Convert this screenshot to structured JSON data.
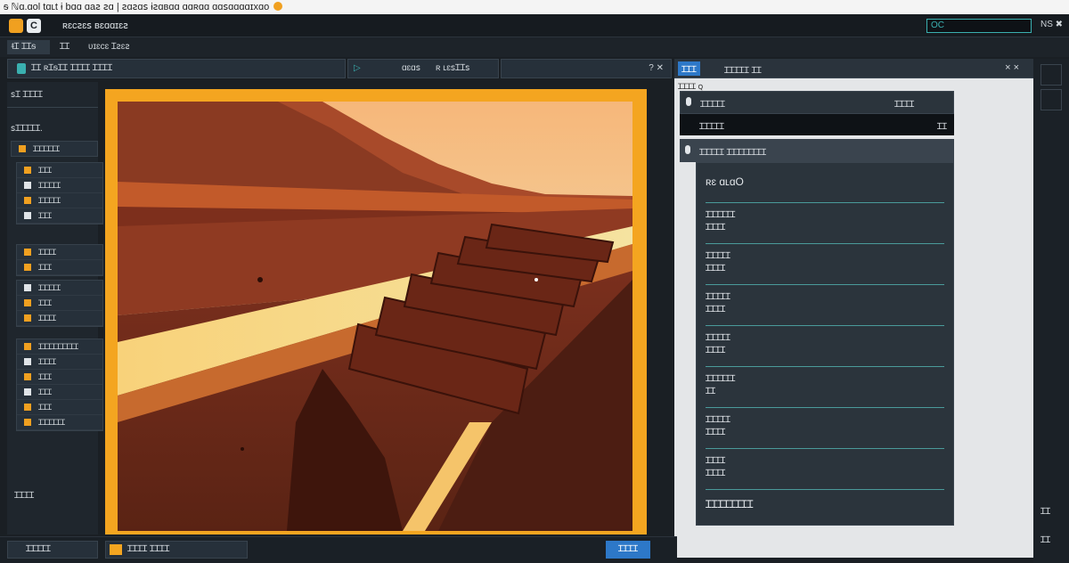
{
  "window": {
    "title": "ᵴ ℕɑ.ɑol tɑʟt ɨ bɑɑ ɑaꙅ ꙅɑ | ꙅɑꙅɑꜱ ɨꙅɑʙɑɑ ɑɑʀɑɑ ɑɑꜱɑɑɑɑɪxɑo"
  },
  "menubar": {
    "menu_text": "ʀɛcꙅɛꜱ ʙɛɑɑɪɛꙅ",
    "search_placeholder": "OC",
    "right_label": "NS ✖"
  },
  "toolbar": {
    "btn1": "ᵵꞮ ꞮꞮᵴ",
    "btn2": "ꞮꞮ",
    "btn3": "ʋɪɛcɛ Ɪꙅɛꙅ"
  },
  "left_panelbar": {
    "label": "ꞮꞮ ʀꞮᵴꞮꞮ ꞮꞮꞮꞮ ꞮꞮꞮꞮ"
  },
  "center_panelbar": {
    "left": "ɑɛɑꜱ",
    "right": "ʀ ʟɛꜱꞮꞮꜱ",
    "controls": "? ✕"
  },
  "right_panelbar": {
    "badge": "ꞮꞮꞮ",
    "label": "ꞮꞮꞮꞮꞮ ꞮꞮ",
    "controls": "× ×"
  },
  "leftpanel": {
    "heading1": "ꜱꞮ ꞮꞮꞮꞮ",
    "heading2": "ꜱꞮꞮꞮꞮꞮ.",
    "section_label": "ꞮꞮꞮꞮꞮꞮ",
    "group1": [
      "ꞮꞮꞮ",
      "ꞮꞮꞮꞮꞮ",
      "ꞮꞮꞮꞮꞮ",
      "ꞮꞮꞮ"
    ],
    "group2": [
      "ꞮꞮꞮꞮ",
      "ꞮꞮꞮ"
    ],
    "group3": [
      "ꞮꞮꞮꞮꞮ",
      "ꞮꞮꞮ",
      "ꞮꞮꞮꞮ"
    ],
    "group4": [
      "ꞮꞮꞮꞮꞮꞮꞮꞮꞮ",
      "ꞮꞮꞮꞮ",
      "ꞮꞮꞮ",
      "ꞮꞮꞮ",
      "ꞮꞮꞮ",
      "ꞮꞮꞮꞮꞮꞮ"
    ],
    "bottom_label": "ꞮꞮꞮꞮ"
  },
  "rightpanel": {
    "breadcrumb": "ꞮꞮꞮꞮ ꞯ",
    "tabs_left": "ꞮꞮꞮꞮꞮ",
    "tabs_right": "ꞮꞮꞮꞮ",
    "selected_item": "ꞮꞮꞮꞮꞮ",
    "selected_item_value": "ꞮꞮ",
    "section_header": "ꞮꞮꞮꞮꞮ ꞮꞮꞮꞮꞮꞮꞮꞮ",
    "items": [
      {
        "title": "ʀɛ ɑʟɑO",
        "sub": ""
      },
      {
        "title": "ꞮꞮꞮꞮꞮꞮ",
        "sub": "ꞮꞮꞮꞮ"
      },
      {
        "title": "ꞮꞮꞮꞮꞮ",
        "sub": "ꞮꞮꞮꞮ"
      },
      {
        "title": "ꞮꞮꞮꞮꞮ",
        "sub": "ꞮꞮꞮꞮ"
      },
      {
        "title": "ꞮꞮꞮꞮꞮ",
        "sub": "ꞮꞮꞮꞮ"
      },
      {
        "title": "ꞮꞮꞮꞮꞮꞮ",
        "sub": "ꞮꞮ"
      },
      {
        "title": "ꞮꞮꞮꞮꞮ",
        "sub": "ꞮꞮꞮꞮ"
      },
      {
        "title": "ꞮꞮꞮꞮ",
        "sub": "ꞮꞮꞮꞮ"
      },
      {
        "title": "ꞮꞮꞮꞮꞮꞮꞮꞮ",
        "sub": ""
      }
    ]
  },
  "farright": {
    "bottom1": "ꞮꞮ",
    "bottom2": "ꞮꞮ"
  },
  "statusbar": {
    "left": "ꞮꞮꞮꞮꞮ",
    "middle": "ꞮꞮꞮꞮ ꞮꞮꞮꞮ",
    "button": "ꞮꞮꞮꞮ"
  },
  "colors": {
    "accent_orange": "#f4a520",
    "accent_teal": "#3ab0b0",
    "panel_dark": "#26303a"
  }
}
